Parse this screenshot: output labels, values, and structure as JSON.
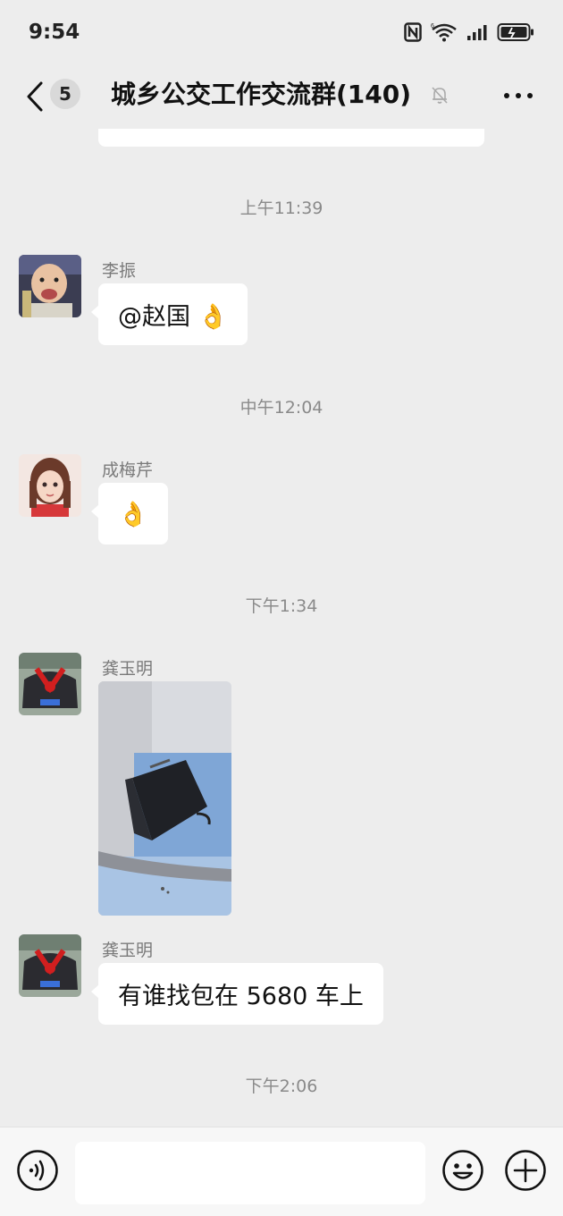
{
  "status": {
    "time": "9:54"
  },
  "header": {
    "unread_count": "5",
    "title": "城乡公交工作交流群(140)"
  },
  "messages": [
    {
      "timestamp": "上午11:39",
      "sender": "李振",
      "text": "@赵国 👌"
    },
    {
      "timestamp": "中午12:04",
      "sender": "成梅芹",
      "text": "👌"
    },
    {
      "timestamp": "下午1:34",
      "sender": "龚玉明",
      "text": ""
    },
    {
      "timestamp": "",
      "sender": "龚玉明",
      "text": "有谁找包在 5680 车上"
    },
    {
      "timestamp": "下午2:06",
      "sender": "",
      "text": ""
    }
  ],
  "colors": {
    "background": "#ededed",
    "bubble": "#ffffff",
    "timestamp_text": "#8a8a8a"
  },
  "icons": {
    "back": "chevron-left-icon",
    "mute": "bell-off-icon",
    "more": "more-horizontal-icon",
    "voice": "voice-icon",
    "emoji": "emoji-icon",
    "plus": "plus-circle-icon"
  }
}
